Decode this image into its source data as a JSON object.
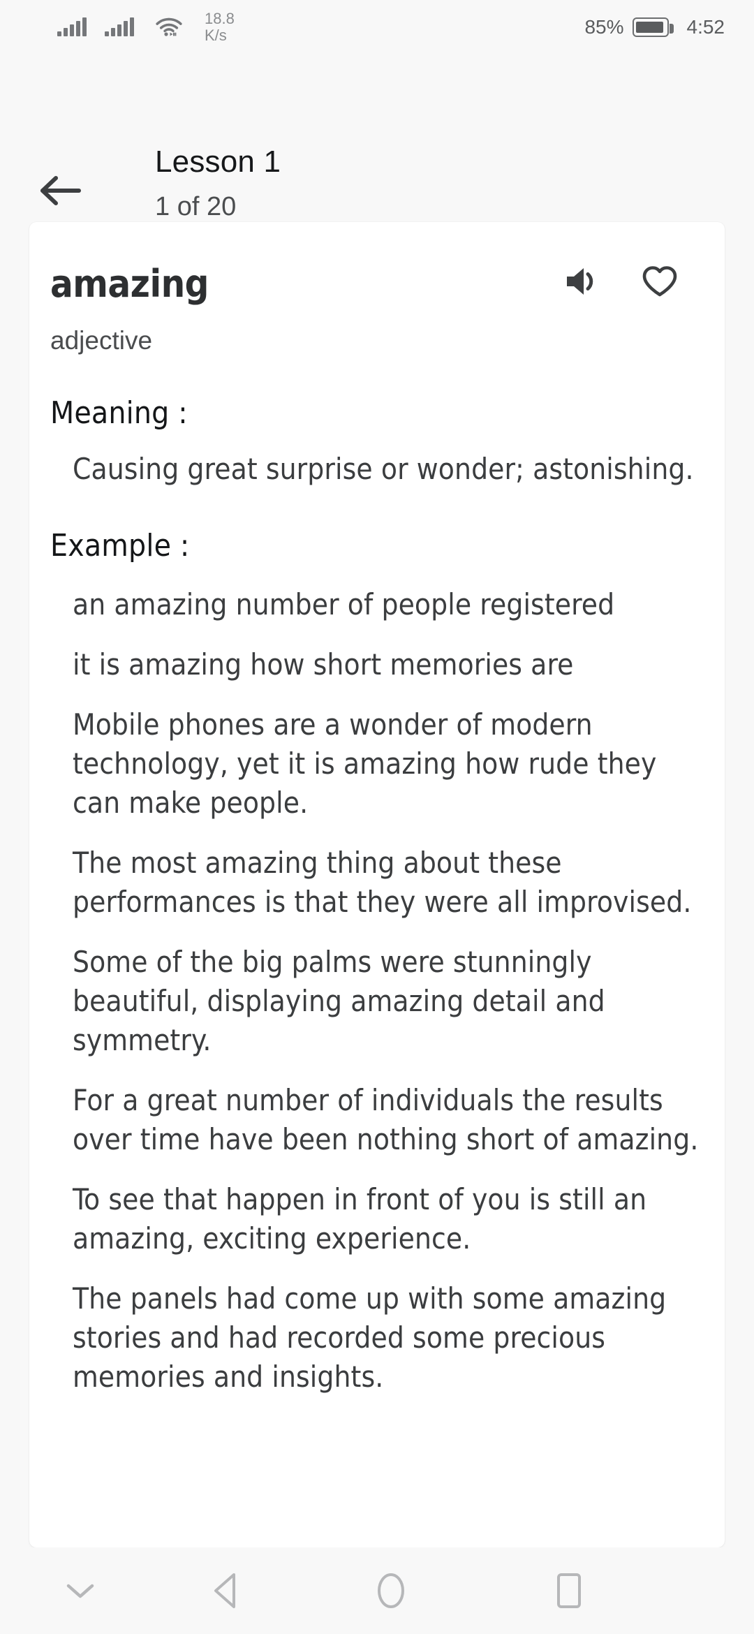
{
  "status_bar": {
    "signal_icon_1": "signal-bars-icon",
    "signal_icon_2": "signal-bars-icon",
    "wifi_icon": "wifi-icon",
    "net_speed_value": "18.8",
    "net_speed_unit": "K/s",
    "battery_percent": "85%",
    "battery_icon": "battery-icon",
    "battery_level": 85,
    "clock": "4:52"
  },
  "header": {
    "back_icon": "arrow-left-icon",
    "title": "Lesson 1",
    "subtitle": "1 of 20"
  },
  "card": {
    "word": "amazing",
    "speaker_icon": "speaker-icon",
    "favorite_icon": "heart-outline-icon",
    "part_of_speech": "adjective",
    "meaning_label": "Meaning :",
    "meaning_text": "Causing great surprise or wonder; astonishing.",
    "example_label": "Example :",
    "examples": [
      "an amazing number of people registered",
      "it is amazing how short memories are",
      "Mobile phones are a wonder of modern technology, yet it is amazing how rude they can make people.",
      "The most amazing thing about these performances is that they were all improvised.",
      "Some of the big palms were stunningly beautiful, displaying amazing detail and symmetry.",
      "For a great number of individuals the results over time have been nothing short of amazing.",
      "To see that happen in front of you is still an amazing, exciting experience.",
      "The panels had come up with some amazing stories and had recorded some precious memories and insights."
    ]
  },
  "nav_bar": {
    "hide_keyboard_icon": "chevron-down-icon",
    "back_icon": "triangle-back-icon",
    "home_icon": "circle-home-icon",
    "recents_icon": "square-recents-icon"
  },
  "colors": {
    "page_background": "#f8f8f8",
    "card_background": "#ffffff",
    "primary_text": "#16181a",
    "body_text": "#3b3d3f",
    "muted_text": "#8a8c8e",
    "icon": "#3d3f41",
    "nav_icon": "#b6b7b9"
  }
}
